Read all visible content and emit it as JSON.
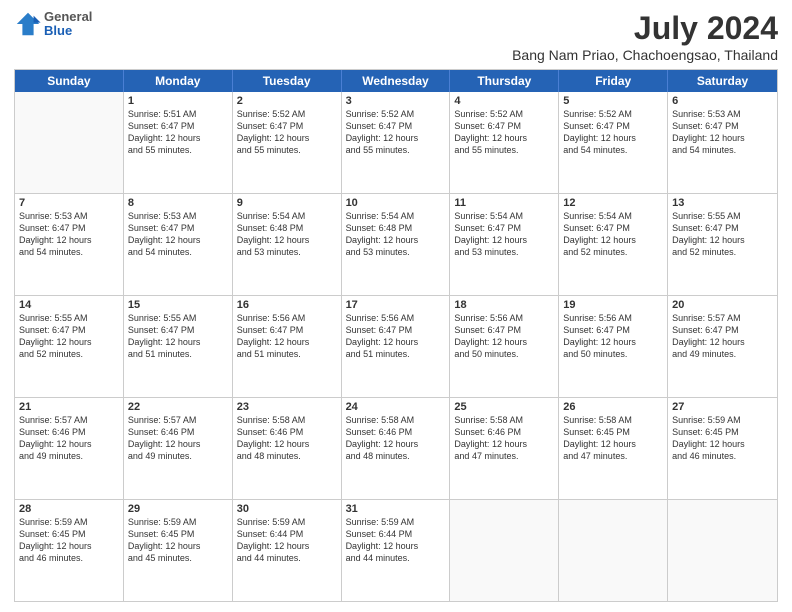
{
  "logo": {
    "general": "General",
    "blue": "Blue"
  },
  "title": "July 2024",
  "subtitle": "Bang Nam Priao, Chachoengsao, Thailand",
  "header_days": [
    "Sunday",
    "Monday",
    "Tuesday",
    "Wednesday",
    "Thursday",
    "Friday",
    "Saturday"
  ],
  "weeks": [
    [
      {
        "day": "",
        "lines": []
      },
      {
        "day": "1",
        "lines": [
          "Sunrise: 5:51 AM",
          "Sunset: 6:47 PM",
          "Daylight: 12 hours",
          "and 55 minutes."
        ]
      },
      {
        "day": "2",
        "lines": [
          "Sunrise: 5:52 AM",
          "Sunset: 6:47 PM",
          "Daylight: 12 hours",
          "and 55 minutes."
        ]
      },
      {
        "day": "3",
        "lines": [
          "Sunrise: 5:52 AM",
          "Sunset: 6:47 PM",
          "Daylight: 12 hours",
          "and 55 minutes."
        ]
      },
      {
        "day": "4",
        "lines": [
          "Sunrise: 5:52 AM",
          "Sunset: 6:47 PM",
          "Daylight: 12 hours",
          "and 55 minutes."
        ]
      },
      {
        "day": "5",
        "lines": [
          "Sunrise: 5:52 AM",
          "Sunset: 6:47 PM",
          "Daylight: 12 hours",
          "and 54 minutes."
        ]
      },
      {
        "day": "6",
        "lines": [
          "Sunrise: 5:53 AM",
          "Sunset: 6:47 PM",
          "Daylight: 12 hours",
          "and 54 minutes."
        ]
      }
    ],
    [
      {
        "day": "7",
        "lines": [
          "Sunrise: 5:53 AM",
          "Sunset: 6:47 PM",
          "Daylight: 12 hours",
          "and 54 minutes."
        ]
      },
      {
        "day": "8",
        "lines": [
          "Sunrise: 5:53 AM",
          "Sunset: 6:47 PM",
          "Daylight: 12 hours",
          "and 54 minutes."
        ]
      },
      {
        "day": "9",
        "lines": [
          "Sunrise: 5:54 AM",
          "Sunset: 6:48 PM",
          "Daylight: 12 hours",
          "and 53 minutes."
        ]
      },
      {
        "day": "10",
        "lines": [
          "Sunrise: 5:54 AM",
          "Sunset: 6:48 PM",
          "Daylight: 12 hours",
          "and 53 minutes."
        ]
      },
      {
        "day": "11",
        "lines": [
          "Sunrise: 5:54 AM",
          "Sunset: 6:47 PM",
          "Daylight: 12 hours",
          "and 53 minutes."
        ]
      },
      {
        "day": "12",
        "lines": [
          "Sunrise: 5:54 AM",
          "Sunset: 6:47 PM",
          "Daylight: 12 hours",
          "and 52 minutes."
        ]
      },
      {
        "day": "13",
        "lines": [
          "Sunrise: 5:55 AM",
          "Sunset: 6:47 PM",
          "Daylight: 12 hours",
          "and 52 minutes."
        ]
      }
    ],
    [
      {
        "day": "14",
        "lines": [
          "Sunrise: 5:55 AM",
          "Sunset: 6:47 PM",
          "Daylight: 12 hours",
          "and 52 minutes."
        ]
      },
      {
        "day": "15",
        "lines": [
          "Sunrise: 5:55 AM",
          "Sunset: 6:47 PM",
          "Daylight: 12 hours",
          "and 51 minutes."
        ]
      },
      {
        "day": "16",
        "lines": [
          "Sunrise: 5:56 AM",
          "Sunset: 6:47 PM",
          "Daylight: 12 hours",
          "and 51 minutes."
        ]
      },
      {
        "day": "17",
        "lines": [
          "Sunrise: 5:56 AM",
          "Sunset: 6:47 PM",
          "Daylight: 12 hours",
          "and 51 minutes."
        ]
      },
      {
        "day": "18",
        "lines": [
          "Sunrise: 5:56 AM",
          "Sunset: 6:47 PM",
          "Daylight: 12 hours",
          "and 50 minutes."
        ]
      },
      {
        "day": "19",
        "lines": [
          "Sunrise: 5:56 AM",
          "Sunset: 6:47 PM",
          "Daylight: 12 hours",
          "and 50 minutes."
        ]
      },
      {
        "day": "20",
        "lines": [
          "Sunrise: 5:57 AM",
          "Sunset: 6:47 PM",
          "Daylight: 12 hours",
          "and 49 minutes."
        ]
      }
    ],
    [
      {
        "day": "21",
        "lines": [
          "Sunrise: 5:57 AM",
          "Sunset: 6:46 PM",
          "Daylight: 12 hours",
          "and 49 minutes."
        ]
      },
      {
        "day": "22",
        "lines": [
          "Sunrise: 5:57 AM",
          "Sunset: 6:46 PM",
          "Daylight: 12 hours",
          "and 49 minutes."
        ]
      },
      {
        "day": "23",
        "lines": [
          "Sunrise: 5:58 AM",
          "Sunset: 6:46 PM",
          "Daylight: 12 hours",
          "and 48 minutes."
        ]
      },
      {
        "day": "24",
        "lines": [
          "Sunrise: 5:58 AM",
          "Sunset: 6:46 PM",
          "Daylight: 12 hours",
          "and 48 minutes."
        ]
      },
      {
        "day": "25",
        "lines": [
          "Sunrise: 5:58 AM",
          "Sunset: 6:46 PM",
          "Daylight: 12 hours",
          "and 47 minutes."
        ]
      },
      {
        "day": "26",
        "lines": [
          "Sunrise: 5:58 AM",
          "Sunset: 6:45 PM",
          "Daylight: 12 hours",
          "and 47 minutes."
        ]
      },
      {
        "day": "27",
        "lines": [
          "Sunrise: 5:59 AM",
          "Sunset: 6:45 PM",
          "Daylight: 12 hours",
          "and 46 minutes."
        ]
      }
    ],
    [
      {
        "day": "28",
        "lines": [
          "Sunrise: 5:59 AM",
          "Sunset: 6:45 PM",
          "Daylight: 12 hours",
          "and 46 minutes."
        ]
      },
      {
        "day": "29",
        "lines": [
          "Sunrise: 5:59 AM",
          "Sunset: 6:45 PM",
          "Daylight: 12 hours",
          "and 45 minutes."
        ]
      },
      {
        "day": "30",
        "lines": [
          "Sunrise: 5:59 AM",
          "Sunset: 6:44 PM",
          "Daylight: 12 hours",
          "and 44 minutes."
        ]
      },
      {
        "day": "31",
        "lines": [
          "Sunrise: 5:59 AM",
          "Sunset: 6:44 PM",
          "Daylight: 12 hours",
          "and 44 minutes."
        ]
      },
      {
        "day": "",
        "lines": []
      },
      {
        "day": "",
        "lines": []
      },
      {
        "day": "",
        "lines": []
      }
    ]
  ]
}
